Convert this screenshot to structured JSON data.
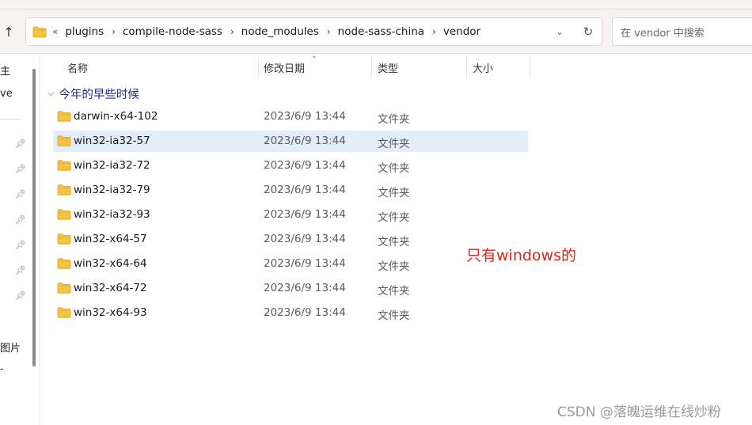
{
  "toolbar": {
    "up_icon": "↑"
  },
  "address": {
    "overflow": "«",
    "crumbs": [
      "plugins",
      "compile-node-sass",
      "node_modules",
      "node-sass-china",
      "vendor"
    ],
    "dropdown_icon": "⌄",
    "refresh_icon": "↻"
  },
  "search": {
    "placeholder": "在 vendor 中搜索"
  },
  "nav": {
    "partial_top": "主",
    "partial_second": "ve",
    "partial_pictures": "图片",
    "partial_bottom": "-"
  },
  "columns": {
    "name": "名称",
    "date": "修改日期",
    "type": "类型",
    "size": "大小"
  },
  "group": {
    "label": "今年的早些时候"
  },
  "rows": [
    {
      "name": "darwin-x64-102",
      "date": "2023/6/9 13:44",
      "type": "文件夹"
    },
    {
      "name": "win32-ia32-57",
      "date": "2023/6/9 13:44",
      "type": "文件夹"
    },
    {
      "name": "win32-ia32-72",
      "date": "2023/6/9 13:44",
      "type": "文件夹"
    },
    {
      "name": "win32-ia32-79",
      "date": "2023/6/9 13:44",
      "type": "文件夹"
    },
    {
      "name": "win32-ia32-93",
      "date": "2023/6/9 13:44",
      "type": "文件夹"
    },
    {
      "name": "win32-x64-57",
      "date": "2023/6/9 13:44",
      "type": "文件夹"
    },
    {
      "name": "win32-x64-64",
      "date": "2023/6/9 13:44",
      "type": "文件夹"
    },
    {
      "name": "win32-x64-72",
      "date": "2023/6/9 13:44",
      "type": "文件夹"
    },
    {
      "name": "win32-x64-93",
      "date": "2023/6/9 13:44",
      "type": "文件夹"
    }
  ],
  "annotation": "只有windows的",
  "watermark": "CSDN @落魄运维在线炒粉",
  "colors": {
    "folder": "#f6c244",
    "selection": "#e3eefb",
    "annotation": "#e0241b",
    "group_header": "#1b2f7a"
  }
}
